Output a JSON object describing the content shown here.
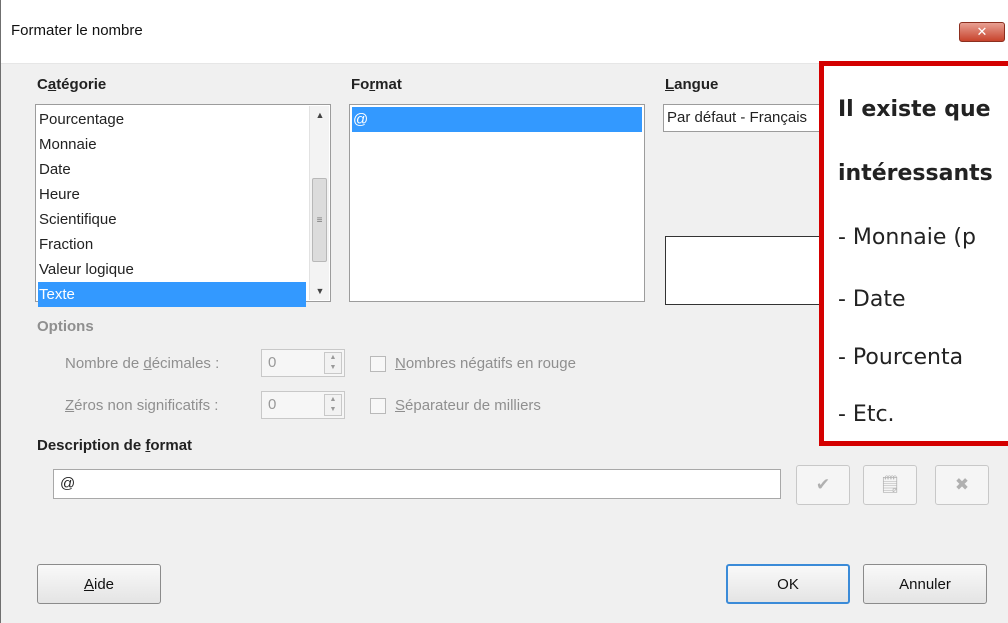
{
  "window": {
    "title": "Formater le nombre",
    "close_glyph": "✕"
  },
  "category": {
    "label_pre": "C",
    "label_ul": "a",
    "label_post": "tégorie",
    "items": [
      "Pourcentage",
      "Monnaie",
      "Date",
      "Heure",
      "Scientifique",
      "Fraction",
      "Valeur logique",
      "Texte"
    ],
    "selected_index": 7
  },
  "format": {
    "label_pre": "Fo",
    "label_ul": "r",
    "label_post": "mat",
    "items": [
      "@"
    ],
    "selected_index": 0
  },
  "language": {
    "label_ul": "L",
    "label_post": "angue",
    "value": "Par défaut - Français"
  },
  "options": {
    "title": "Options",
    "decimals_pre": "Nombre de ",
    "decimals_ul": "d",
    "decimals_post": "écimales :",
    "decimals_value": "0",
    "zeros_ul": "Z",
    "zeros_post": "éros non significatifs :",
    "zeros_value": "0",
    "negative_ul": "N",
    "negative_post": "ombres négatifs en rouge",
    "negative_checked": false,
    "thousands_ul": "S",
    "thousands_post": "éparateur de milliers",
    "thousands_checked": false
  },
  "description": {
    "label_pre": "Description de ",
    "label_ul": "f",
    "label_post": "ormat",
    "value": "@",
    "icons": [
      "checkmark-icon",
      "comment-icon",
      "delete-icon"
    ]
  },
  "buttons": {
    "help_ul": "A",
    "help_post": "ide",
    "ok": "OK",
    "cancel": "Annuler"
  },
  "callout": {
    "line1": "Il existe que",
    "line2": "intéressants",
    "line3": "- Monnaie (p",
    "line4": "- Date",
    "line5": "- Pourcenta",
    "line6": "- Etc."
  }
}
